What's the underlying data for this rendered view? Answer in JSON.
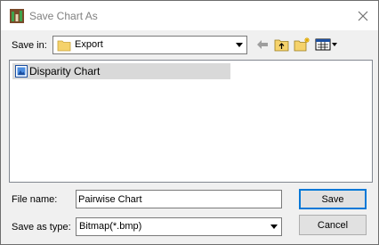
{
  "window": {
    "title": "Save Chart As",
    "app_icon": "chart-app-icon",
    "close_icon": "close-icon"
  },
  "save_in": {
    "label": "Save in:",
    "value": "Export",
    "folder_icon": "folder-icon"
  },
  "toolbar": {
    "icons": [
      "back-arrow-icon",
      "up-folder-icon",
      "new-folder-icon",
      "view-menu-icon"
    ]
  },
  "file_list": {
    "items": [
      {
        "name": "Disparity Chart",
        "icon": "bitmap-file-icon",
        "selected": true
      }
    ]
  },
  "file_name": {
    "label": "File name:",
    "value": "Pairwise Chart"
  },
  "save_as_type": {
    "label": "Save as type:",
    "value": "Bitmap(*.bmp)"
  },
  "buttons": {
    "save": "Save",
    "cancel": "Cancel"
  },
  "colors": {
    "dialog_bg": "#f0f0f0",
    "selection": "#d9d9d9",
    "default_button_border": "#0078d7",
    "folder_yellow": "#f5d26b"
  }
}
